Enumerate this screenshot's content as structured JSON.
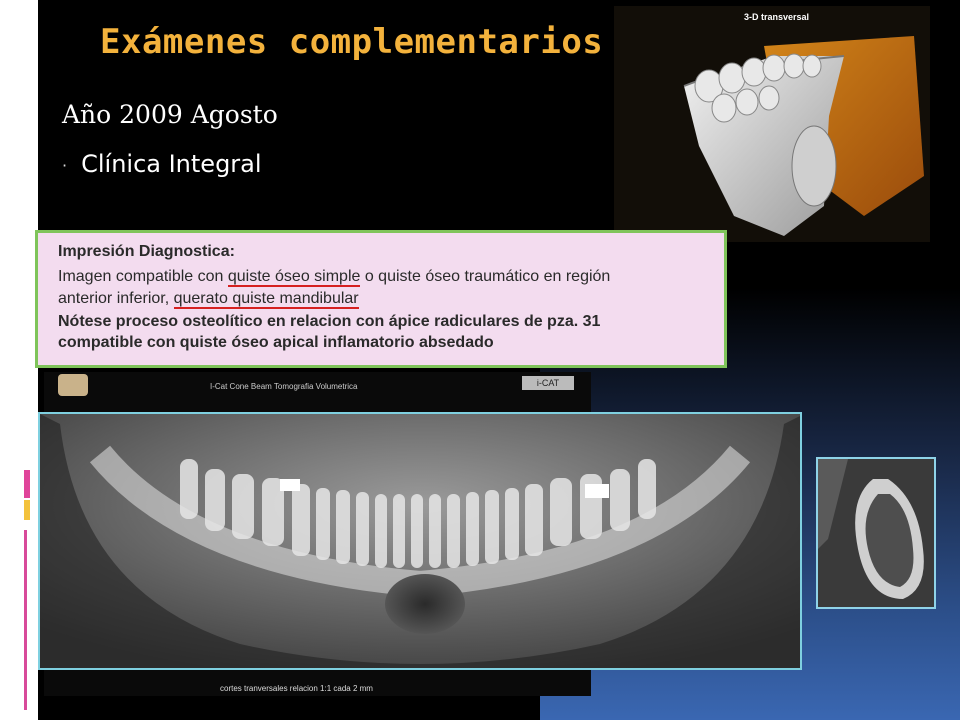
{
  "slide": {
    "title": "Exámenes complementarios",
    "subtitle": "Año 2009 Agosto",
    "bullet": "Clínica Integral",
    "bullet_marker": "·",
    "accent_color": "#f3b23c"
  },
  "image3d": {
    "label": "3-D transversal"
  },
  "diagnosis": {
    "heading": "Impresión Diagnostica:",
    "line1_pre": "Imagen compatible con ",
    "line1_ul": "quiste óseo simple",
    "line1_post": " o quiste óseo traumático en región",
    "line2_pre": "anterior inferior, ",
    "line2_ul": "querato quiste mandibular",
    "line3": "Nótese proceso osteolítico en relacion con ápice radiculares de pza. 31",
    "line4": "compatible con quiste óseo apical inflamatorio absedado",
    "underline_color": "#d62020",
    "border_color": "#7fc45a"
  },
  "panoramic": {
    "header": "I-Cat Cone Beam Tomografia Volumetrica",
    "logo_right": "i-CAT",
    "footer": "cortes tranversales relacion 1:1 cada 2 mm"
  }
}
